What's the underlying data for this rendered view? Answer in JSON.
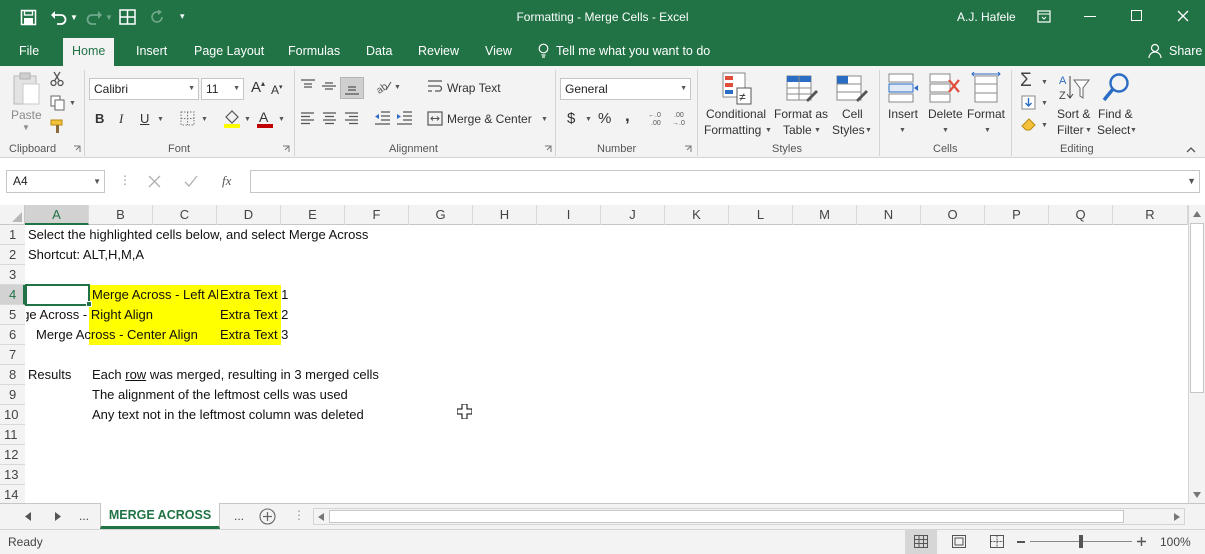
{
  "titlebar": {
    "title": "Formatting - Merge Cells  -  Excel",
    "user": "A.J. Hafele"
  },
  "tabs": [
    "File",
    "Home",
    "Insert",
    "Page Layout",
    "Formulas",
    "Data",
    "Review",
    "View"
  ],
  "tell_me": "Tell me what you want to do",
  "share": "Share",
  "ribbon": {
    "paste": "Paste",
    "clipboard": "Clipboard",
    "font_name": "Calibri",
    "font_size": "11",
    "font_group": "Font",
    "bold": "B",
    "italic": "I",
    "underline": "U",
    "wrap_text": "Wrap Text",
    "merge_center": "Merge & Center",
    "alignment_group": "Alignment",
    "number_format": "General",
    "number_group": "Number",
    "currency": "$",
    "percent": "%",
    "comma": ",",
    "conditional_formatting_1": "Conditional",
    "conditional_formatting_2": "Formatting",
    "format_as_table_1": "Format as",
    "format_as_table_2": "Table",
    "cell_styles_1": "Cell",
    "cell_styles_2": "Styles",
    "styles_group": "Styles",
    "insert": "Insert",
    "delete": "Delete",
    "format": "Format",
    "cells_group": "Cells",
    "sort_filter_1": "Sort &",
    "sort_filter_2": "Filter",
    "find_select_1": "Find &",
    "find_select_2": "Select",
    "editing_group": "Editing"
  },
  "formula_bar": {
    "name_box": "A4",
    "fx": "fx",
    "formula": ""
  },
  "columns": [
    "A",
    "B",
    "C",
    "D",
    "E",
    "F",
    "G",
    "H",
    "I",
    "J",
    "K",
    "L",
    "M",
    "N",
    "O",
    "P",
    "Q",
    "R"
  ],
  "rows": [
    "1",
    "2",
    "3",
    "4",
    "5",
    "6",
    "7",
    "8",
    "9",
    "10",
    "11",
    "12",
    "13",
    "14"
  ],
  "cells": {
    "r1": "Select the highlighted cells below, and select Merge Across",
    "r2": "Shortcut: ALT,H,M,A",
    "r4_b": "Merge Across - Left Align",
    "r4_d": "Extra Text 1",
    "r5_a": "Merge Across - Right Align",
    "r5_d": "Extra Text 2",
    "r6_a": "Merge Across - Center Align",
    "r6_d": "Extra Text 3",
    "r8_a": "Results",
    "r8_b_pre": "Each ",
    "r8_b_u": "row",
    "r8_b_post": " was merged, resulting in 3 merged cells",
    "r9_b": "The alignment of the leftmost cells was used",
    "r10_b": "Any text not in the leftmost column was deleted"
  },
  "sheet_tabs": {
    "ellipsis_left": "...",
    "active": "MERGE ACROSS",
    "ellipsis_right": "..."
  },
  "status": {
    "ready": "Ready",
    "zoom": "100%"
  },
  "colors": {
    "excel_green": "#217346",
    "highlight": "#ffff00"
  }
}
